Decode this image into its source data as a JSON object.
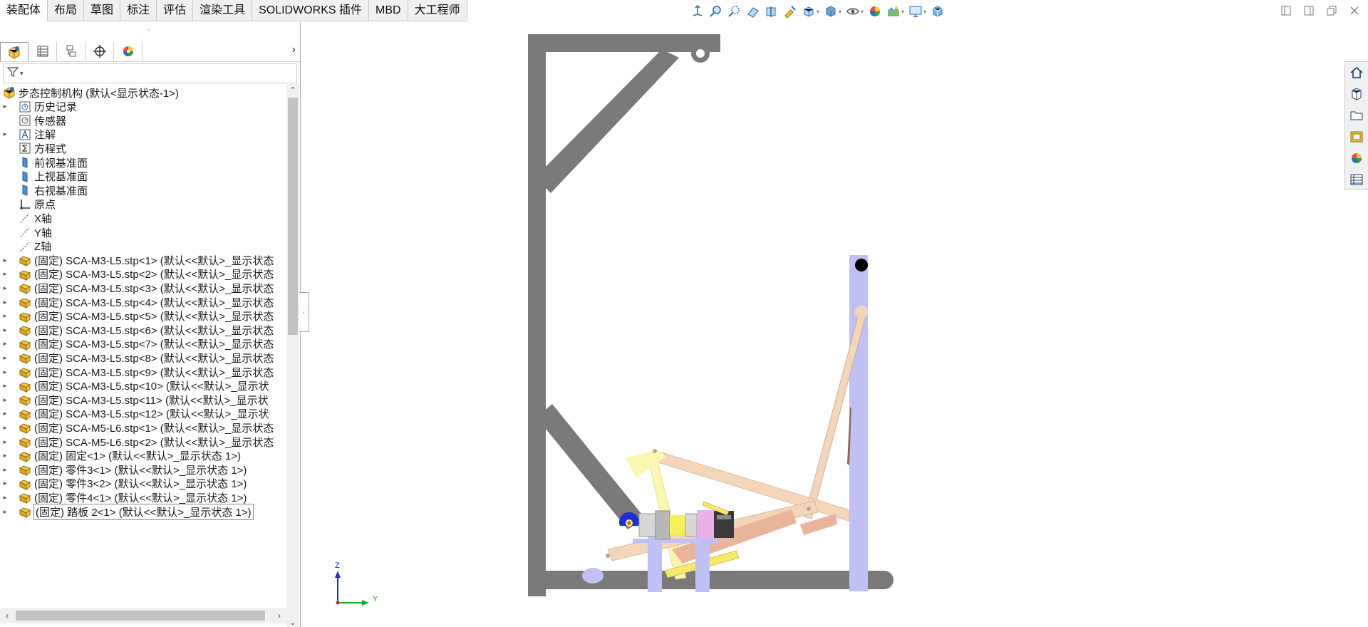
{
  "command_tabs": [
    {
      "label": "装配体",
      "active": true
    },
    {
      "label": "布局"
    },
    {
      "label": "草图"
    },
    {
      "label": "标注"
    },
    {
      "label": "评估"
    },
    {
      "label": "渲染工具"
    },
    {
      "label": "SOLIDWORKS 插件"
    },
    {
      "label": "MBD"
    },
    {
      "label": "大工程师"
    }
  ],
  "hud_icons": [
    "view-orientation-icon",
    "zoom-to-fit-icon",
    "zoom-to-area-icon",
    "previous-view-icon",
    "section-view-icon",
    "dynamic-annotation-icon",
    "view-orientation-dropdown-icon",
    "display-style-icon",
    "hide-show-items-icon",
    "edit-appearance-icon",
    "apply-scene-icon",
    "view-settings-icon",
    "rotate-cube-icon"
  ],
  "window_controls": [
    "tile-left-icon",
    "tile-right-icon",
    "restore-icon",
    "close-icon"
  ],
  "manager_tabs": [
    "featuremanager-icon",
    "propertymanager-icon",
    "configurationmanager-icon",
    "dimxpert-icon",
    "displaymanager-icon"
  ],
  "panel_grip": "◦",
  "filter_glyph": "▾",
  "tree": {
    "root": "步态控制机构  (默认<显示状态-1>)",
    "items": [
      {
        "label": "历史记录",
        "icon": "history-icon",
        "arrow": "▸"
      },
      {
        "label": "传感器",
        "icon": "sensor-icon",
        "arrow": ""
      },
      {
        "label": "注解",
        "icon": "annotation-icon",
        "arrow": "▸"
      },
      {
        "label": "方程式",
        "icon": "equation-icon",
        "arrow": ""
      },
      {
        "label": "前视基准面",
        "icon": "plane-icon",
        "arrow": ""
      },
      {
        "label": "上视基准面",
        "icon": "plane-icon",
        "arrow": ""
      },
      {
        "label": "右视基准面",
        "icon": "plane-icon",
        "arrow": ""
      },
      {
        "label": "原点",
        "icon": "origin-icon",
        "arrow": ""
      },
      {
        "label": "X轴",
        "icon": "axis-icon",
        "arrow": ""
      },
      {
        "label": "Y轴",
        "icon": "axis-icon",
        "arrow": ""
      },
      {
        "label": "Z轴",
        "icon": "axis-icon",
        "arrow": ""
      },
      {
        "label": "(固定) SCA-M3-L5.stp<1> (默认<<默认>_显示状态",
        "icon": "part-icon",
        "arrow": "▸"
      },
      {
        "label": "(固定) SCA-M3-L5.stp<2> (默认<<默认>_显示状态",
        "icon": "part-icon",
        "arrow": "▸"
      },
      {
        "label": "(固定) SCA-M3-L5.stp<3> (默认<<默认>_显示状态",
        "icon": "part-icon",
        "arrow": "▸"
      },
      {
        "label": "(固定) SCA-M3-L5.stp<4> (默认<<默认>_显示状态",
        "icon": "part-icon",
        "arrow": "▸"
      },
      {
        "label": "(固定) SCA-M3-L5.stp<5> (默认<<默认>_显示状态",
        "icon": "part-icon",
        "arrow": "▸"
      },
      {
        "label": "(固定) SCA-M3-L5.stp<6> (默认<<默认>_显示状态",
        "icon": "part-icon",
        "arrow": "▸"
      },
      {
        "label": "(固定) SCA-M3-L5.stp<7> (默认<<默认>_显示状态",
        "icon": "part-icon",
        "arrow": "▸"
      },
      {
        "label": "(固定) SCA-M3-L5.stp<8> (默认<<默认>_显示状态",
        "icon": "part-icon",
        "arrow": "▸"
      },
      {
        "label": "(固定) SCA-M3-L5.stp<9> (默认<<默认>_显示状态",
        "icon": "part-icon",
        "arrow": "▸"
      },
      {
        "label": "(固定) SCA-M3-L5.stp<10> (默认<<默认>_显示状",
        "icon": "part-icon",
        "arrow": "▸"
      },
      {
        "label": "(固定) SCA-M3-L5.stp<11> (默认<<默认>_显示状",
        "icon": "part-icon",
        "arrow": "▸"
      },
      {
        "label": "(固定) SCA-M3-L5.stp<12> (默认<<默认>_显示状",
        "icon": "part-icon",
        "arrow": "▸"
      },
      {
        "label": "(固定) SCA-M5-L6.stp<1> (默认<<默认>_显示状态",
        "icon": "part-icon",
        "arrow": "▸"
      },
      {
        "label": "(固定) SCA-M5-L6.stp<2> (默认<<默认>_显示状态",
        "icon": "part-icon",
        "arrow": "▸"
      },
      {
        "label": "(固定) 固定<1> (默认<<默认>_显示状态 1>)",
        "icon": "part-icon",
        "arrow": "▸"
      },
      {
        "label": "(固定) 零件3<1> (默认<<默认>_显示状态 1>)",
        "icon": "part-icon",
        "arrow": "▸"
      },
      {
        "label": "(固定) 零件3<2> (默认<<默认>_显示状态 1>)",
        "icon": "part-icon",
        "arrow": "▸"
      },
      {
        "label": "(固定) 零件4<1> (默认<<默认>_显示状态 1>)",
        "icon": "part-icon",
        "arrow": "▸"
      },
      {
        "label": "(固定) 踏板 2<1> (默认<<默认>_显示状态 1>)",
        "icon": "part-icon",
        "arrow": "▸",
        "selected": true
      }
    ]
  },
  "scrollbars": {
    "up": "⌃",
    "down": "⌄",
    "left": "‹",
    "right": "›",
    "splitter": "‹"
  },
  "triad": {
    "z": "Z",
    "y": "Y"
  },
  "task_pane_icons": [
    "home-icon",
    "design-library-icon",
    "file-explorer-icon",
    "view-palette-icon",
    "appearances-icon",
    "custom-properties-icon"
  ],
  "colors": {
    "frame": "#7a7a7a",
    "post": "#c0c0f4",
    "link": "#f3d5b9",
    "link_dark": "#e9b49a",
    "yellow_link": "#fbf6b0",
    "motor_pink": "#e8b2e8",
    "triad_z": "#1f2fcf",
    "triad_y": "#18a81c"
  }
}
